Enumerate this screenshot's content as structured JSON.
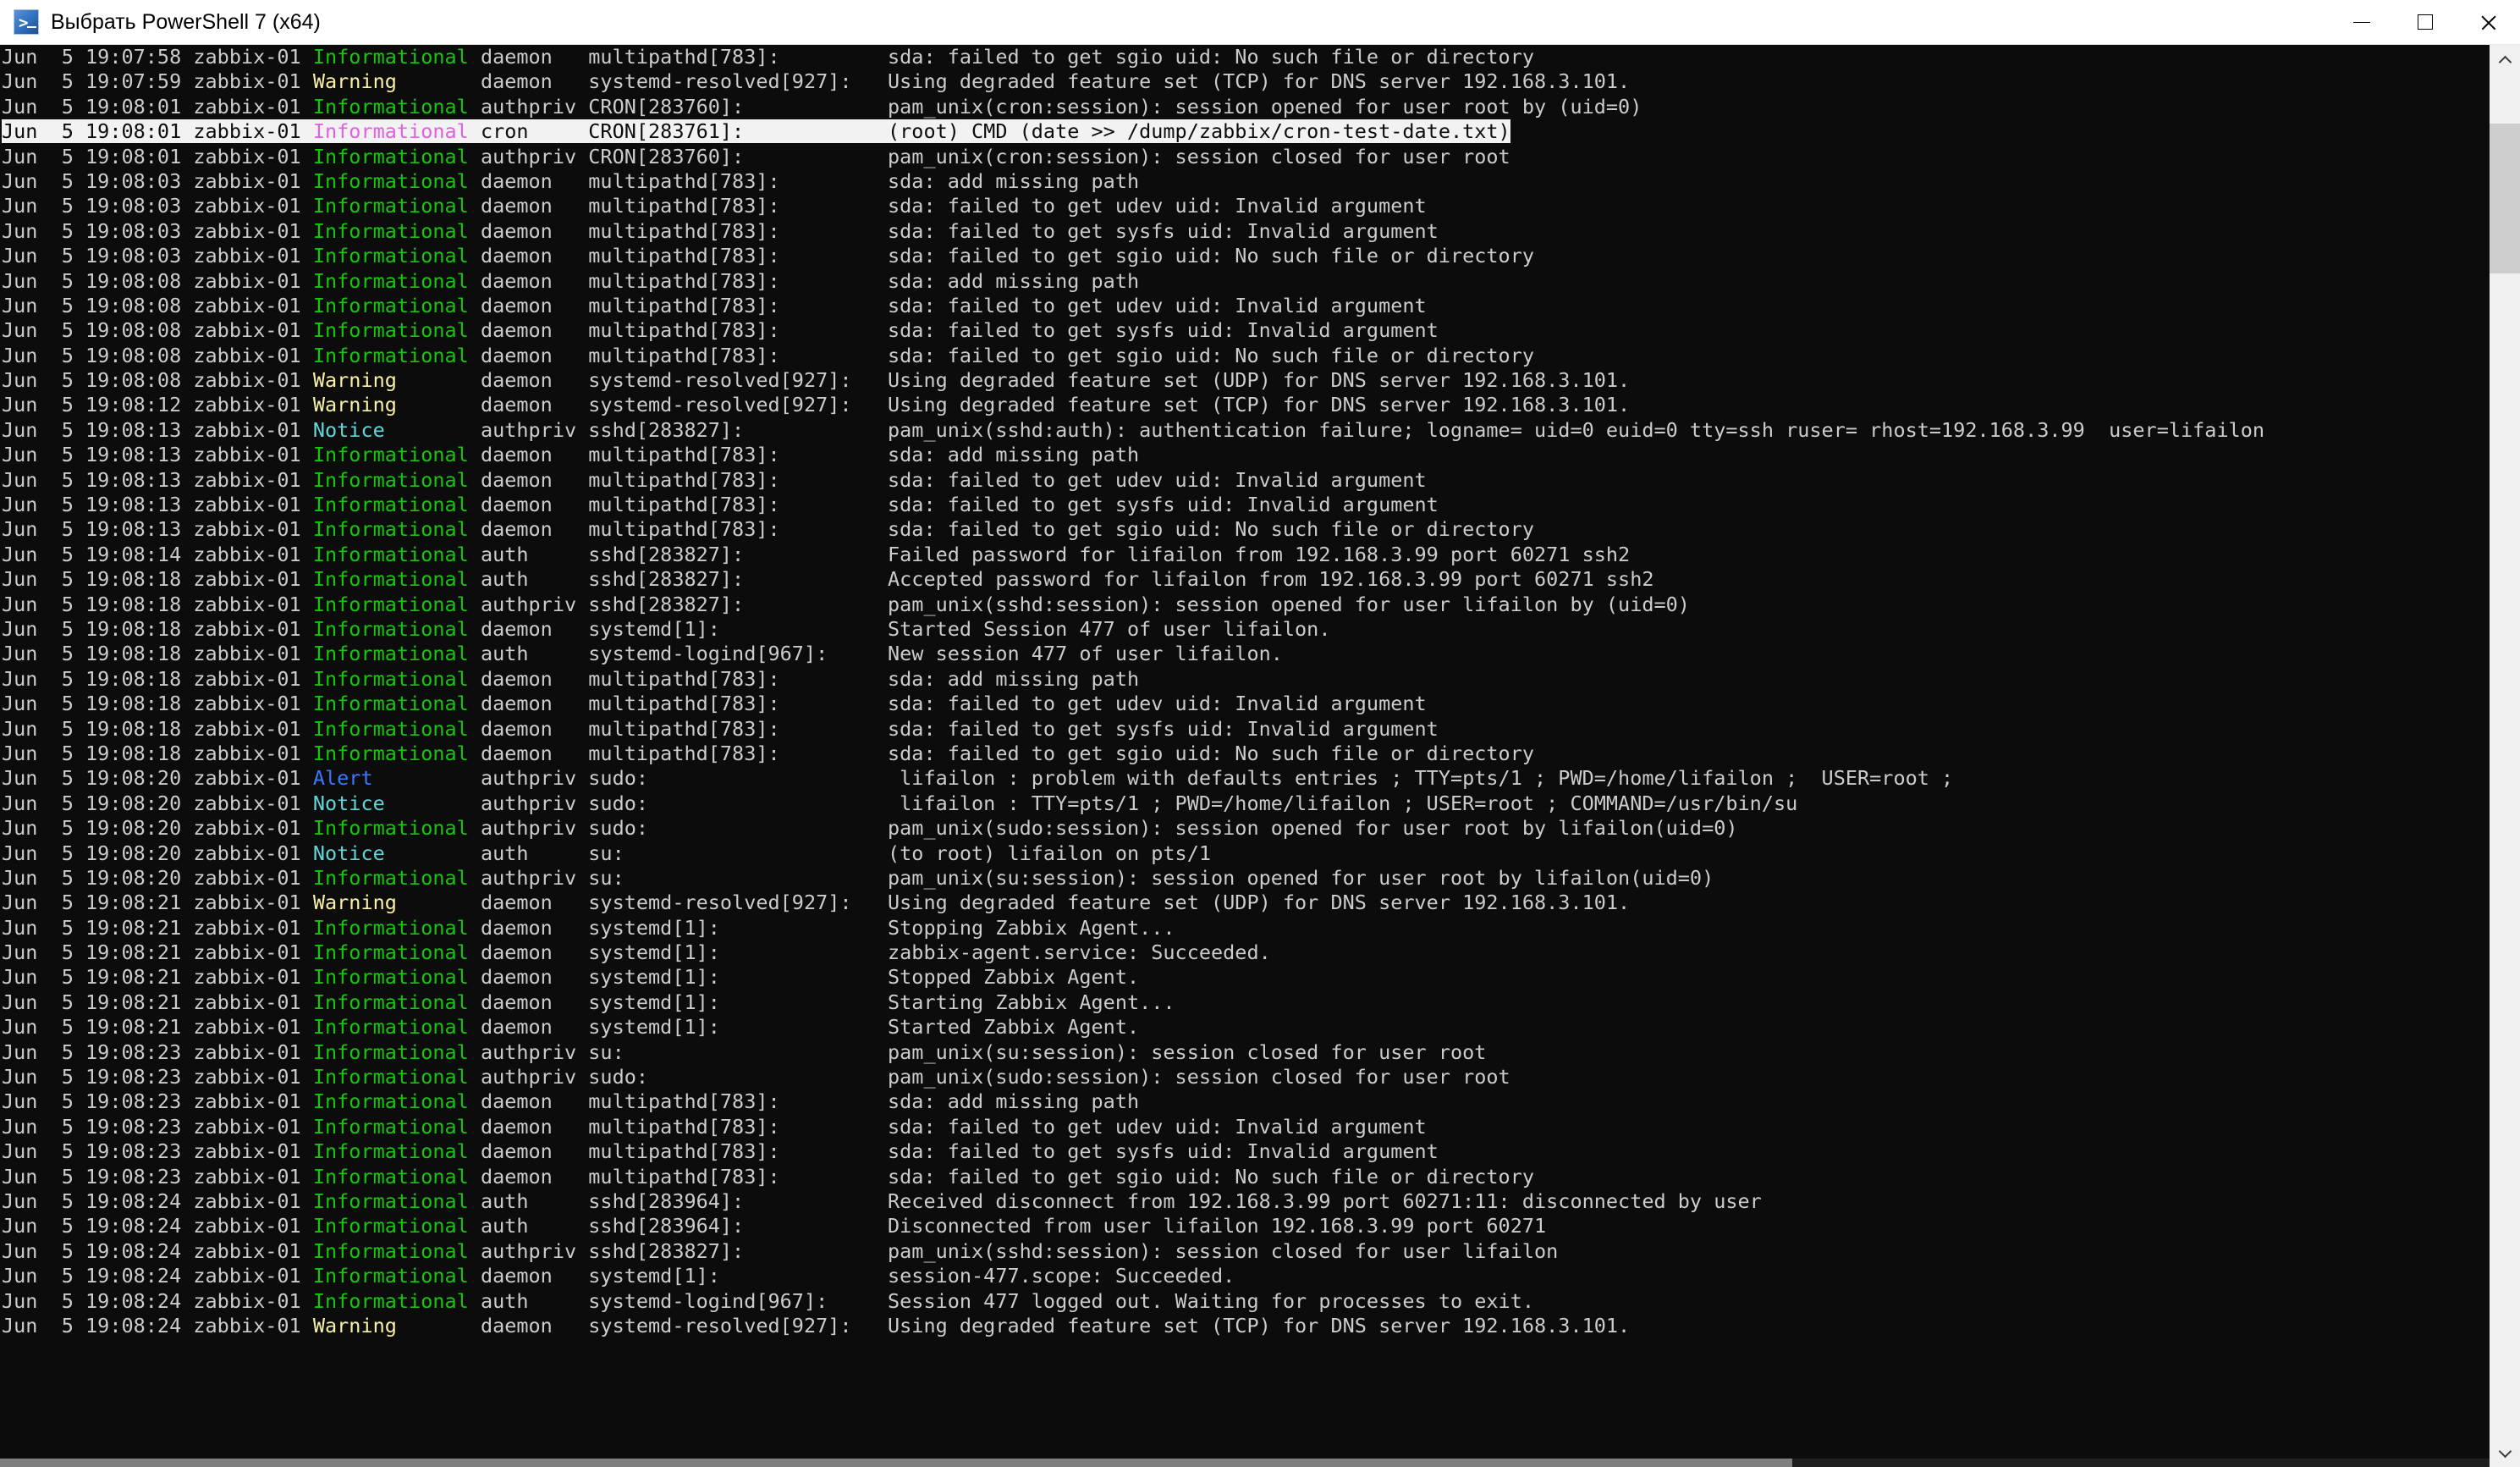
{
  "window": {
    "title": "Выбрать PowerShell 7 (x64)",
    "icon": "powershell-icon",
    "background": "#0c0c0c",
    "titlebar_background": "#ffffff",
    "controls": {
      "minimize": "minimize-icon",
      "maximize": "maximize-icon",
      "close": "close-icon"
    }
  },
  "colors": {
    "informational": "#16c60c",
    "warning": "#f9f1a5",
    "notice": "#61d6d6",
    "alert": "#3b78ff",
    "message": "#cccccc",
    "selection_background": "#f2f2f2",
    "selection_severity": "#e060e0"
  },
  "scrollbars": {
    "vertical": {
      "position_percent": 4,
      "thumb_size_percent": 11
    },
    "horizontal": {
      "position_percent": 0,
      "thumb_size_percent": 72
    }
  },
  "console": {
    "selected_line_index": 3,
    "lines": [
      {
        "ts": "Jun  5 19:07:58 zabbix-01",
        "sev": "Informational",
        "sev_class": "sev-info",
        "facility": "daemon  ",
        "proc": "multipathd[783]:",
        "msg": "sda: failed to get sgio uid: No such file or directory"
      },
      {
        "ts": "Jun  5 19:07:59 zabbix-01",
        "sev": "Warning",
        "sev_class": "sev-warning",
        "facility": "daemon  ",
        "proc": "systemd-resolved[927]:",
        "msg": "Using degraded feature set (TCP) for DNS server 192.168.3.101."
      },
      {
        "ts": "Jun  5 19:08:01 zabbix-01",
        "sev": "Informational",
        "sev_class": "sev-info",
        "facility": "authpriv",
        "proc": "CRON[283760]:",
        "msg": "pam_unix(cron:session): session opened for user root by (uid=0)"
      },
      {
        "ts": "Jun  5 19:08:01 zabbix-01",
        "sev": "Informational",
        "sev_class": "sev-info",
        "facility": "cron    ",
        "proc": "CRON[283761]:",
        "msg": "(root) CMD (date >> /dump/zabbix/cron-test-date.txt)"
      },
      {
        "ts": "Jun  5 19:08:01 zabbix-01",
        "sev": "Informational",
        "sev_class": "sev-info",
        "facility": "authpriv",
        "proc": "CRON[283760]:",
        "msg": "pam_unix(cron:session): session closed for user root"
      },
      {
        "ts": "Jun  5 19:08:03 zabbix-01",
        "sev": "Informational",
        "sev_class": "sev-info",
        "facility": "daemon  ",
        "proc": "multipathd[783]:",
        "msg": "sda: add missing path"
      },
      {
        "ts": "Jun  5 19:08:03 zabbix-01",
        "sev": "Informational",
        "sev_class": "sev-info",
        "facility": "daemon  ",
        "proc": "multipathd[783]:",
        "msg": "sda: failed to get udev uid: Invalid argument"
      },
      {
        "ts": "Jun  5 19:08:03 zabbix-01",
        "sev": "Informational",
        "sev_class": "sev-info",
        "facility": "daemon  ",
        "proc": "multipathd[783]:",
        "msg": "sda: failed to get sysfs uid: Invalid argument"
      },
      {
        "ts": "Jun  5 19:08:03 zabbix-01",
        "sev": "Informational",
        "sev_class": "sev-info",
        "facility": "daemon  ",
        "proc": "multipathd[783]:",
        "msg": "sda: failed to get sgio uid: No such file or directory"
      },
      {
        "ts": "Jun  5 19:08:08 zabbix-01",
        "sev": "Informational",
        "sev_class": "sev-info",
        "facility": "daemon  ",
        "proc": "multipathd[783]:",
        "msg": "sda: add missing path"
      },
      {
        "ts": "Jun  5 19:08:08 zabbix-01",
        "sev": "Informational",
        "sev_class": "sev-info",
        "facility": "daemon  ",
        "proc": "multipathd[783]:",
        "msg": "sda: failed to get udev uid: Invalid argument"
      },
      {
        "ts": "Jun  5 19:08:08 zabbix-01",
        "sev": "Informational",
        "sev_class": "sev-info",
        "facility": "daemon  ",
        "proc": "multipathd[783]:",
        "msg": "sda: failed to get sysfs uid: Invalid argument"
      },
      {
        "ts": "Jun  5 19:08:08 zabbix-01",
        "sev": "Informational",
        "sev_class": "sev-info",
        "facility": "daemon  ",
        "proc": "multipathd[783]:",
        "msg": "sda: failed to get sgio uid: No such file or directory"
      },
      {
        "ts": "Jun  5 19:08:08 zabbix-01",
        "sev": "Warning",
        "sev_class": "sev-warning",
        "facility": "daemon  ",
        "proc": "systemd-resolved[927]:",
        "msg": "Using degraded feature set (UDP) for DNS server 192.168.3.101."
      },
      {
        "ts": "Jun  5 19:08:12 zabbix-01",
        "sev": "Warning",
        "sev_class": "sev-warning",
        "facility": "daemon  ",
        "proc": "systemd-resolved[927]:",
        "msg": "Using degraded feature set (TCP) for DNS server 192.168.3.101."
      },
      {
        "ts": "Jun  5 19:08:13 zabbix-01",
        "sev": "Notice",
        "sev_class": "sev-notice",
        "facility": "authpriv",
        "proc": "sshd[283827]:",
        "msg": "pam_unix(sshd:auth): authentication failure; logname= uid=0 euid=0 tty=ssh ruser= rhost=192.168.3.99  user=lifailon"
      },
      {
        "ts": "Jun  5 19:08:13 zabbix-01",
        "sev": "Informational",
        "sev_class": "sev-info",
        "facility": "daemon  ",
        "proc": "multipathd[783]:",
        "msg": "sda: add missing path"
      },
      {
        "ts": "Jun  5 19:08:13 zabbix-01",
        "sev": "Informational",
        "sev_class": "sev-info",
        "facility": "daemon  ",
        "proc": "multipathd[783]:",
        "msg": "sda: failed to get udev uid: Invalid argument"
      },
      {
        "ts": "Jun  5 19:08:13 zabbix-01",
        "sev": "Informational",
        "sev_class": "sev-info",
        "facility": "daemon  ",
        "proc": "multipathd[783]:",
        "msg": "sda: failed to get sysfs uid: Invalid argument"
      },
      {
        "ts": "Jun  5 19:08:13 zabbix-01",
        "sev": "Informational",
        "sev_class": "sev-info",
        "facility": "daemon  ",
        "proc": "multipathd[783]:",
        "msg": "sda: failed to get sgio uid: No such file or directory"
      },
      {
        "ts": "Jun  5 19:08:14 zabbix-01",
        "sev": "Informational",
        "sev_class": "sev-info",
        "facility": "auth    ",
        "proc": "sshd[283827]:",
        "msg": "Failed password for lifailon from 192.168.3.99 port 60271 ssh2"
      },
      {
        "ts": "Jun  5 19:08:18 zabbix-01",
        "sev": "Informational",
        "sev_class": "sev-info",
        "facility": "auth    ",
        "proc": "sshd[283827]:",
        "msg": "Accepted password for lifailon from 192.168.3.99 port 60271 ssh2"
      },
      {
        "ts": "Jun  5 19:08:18 zabbix-01",
        "sev": "Informational",
        "sev_class": "sev-info",
        "facility": "authpriv",
        "proc": "sshd[283827]:",
        "msg": "pam_unix(sshd:session): session opened for user lifailon by (uid=0)"
      },
      {
        "ts": "Jun  5 19:08:18 zabbix-01",
        "sev": "Informational",
        "sev_class": "sev-info",
        "facility": "daemon  ",
        "proc": "systemd[1]:",
        "msg": "Started Session 477 of user lifailon."
      },
      {
        "ts": "Jun  5 19:08:18 zabbix-01",
        "sev": "Informational",
        "sev_class": "sev-info",
        "facility": "auth    ",
        "proc": "systemd-logind[967]:",
        "msg": "New session 477 of user lifailon."
      },
      {
        "ts": "Jun  5 19:08:18 zabbix-01",
        "sev": "Informational",
        "sev_class": "sev-info",
        "facility": "daemon  ",
        "proc": "multipathd[783]:",
        "msg": "sda: add missing path"
      },
      {
        "ts": "Jun  5 19:08:18 zabbix-01",
        "sev": "Informational",
        "sev_class": "sev-info",
        "facility": "daemon  ",
        "proc": "multipathd[783]:",
        "msg": "sda: failed to get udev uid: Invalid argument"
      },
      {
        "ts": "Jun  5 19:08:18 zabbix-01",
        "sev": "Informational",
        "sev_class": "sev-info",
        "facility": "daemon  ",
        "proc": "multipathd[783]:",
        "msg": "sda: failed to get sysfs uid: Invalid argument"
      },
      {
        "ts": "Jun  5 19:08:18 zabbix-01",
        "sev": "Informational",
        "sev_class": "sev-info",
        "facility": "daemon  ",
        "proc": "multipathd[783]:",
        "msg": "sda: failed to get sgio uid: No such file or directory"
      },
      {
        "ts": "Jun  5 19:08:20 zabbix-01",
        "sev": "Alert",
        "sev_class": "sev-alert",
        "facility": "authpriv",
        "proc": "sudo:",
        "msg": " lifailon : problem with defaults entries ; TTY=pts/1 ; PWD=/home/lifailon ;  USER=root ;"
      },
      {
        "ts": "Jun  5 19:08:20 zabbix-01",
        "sev": "Notice",
        "sev_class": "sev-notice",
        "facility": "authpriv",
        "proc": "sudo:",
        "msg": " lifailon : TTY=pts/1 ; PWD=/home/lifailon ; USER=root ; COMMAND=/usr/bin/su"
      },
      {
        "ts": "Jun  5 19:08:20 zabbix-01",
        "sev": "Informational",
        "sev_class": "sev-info",
        "facility": "authpriv",
        "proc": "sudo:",
        "msg": "pam_unix(sudo:session): session opened for user root by lifailon(uid=0)"
      },
      {
        "ts": "Jun  5 19:08:20 zabbix-01",
        "sev": "Notice",
        "sev_class": "sev-notice",
        "facility": "auth    ",
        "proc": "su:",
        "msg": "(to root) lifailon on pts/1"
      },
      {
        "ts": "Jun  5 19:08:20 zabbix-01",
        "sev": "Informational",
        "sev_class": "sev-info",
        "facility": "authpriv",
        "proc": "su:",
        "msg": "pam_unix(su:session): session opened for user root by lifailon(uid=0)"
      },
      {
        "ts": "Jun  5 19:08:21 zabbix-01",
        "sev": "Warning",
        "sev_class": "sev-warning",
        "facility": "daemon  ",
        "proc": "systemd-resolved[927]:",
        "msg": "Using degraded feature set (UDP) for DNS server 192.168.3.101."
      },
      {
        "ts": "Jun  5 19:08:21 zabbix-01",
        "sev": "Informational",
        "sev_class": "sev-info",
        "facility": "daemon  ",
        "proc": "systemd[1]:",
        "msg": "Stopping Zabbix Agent..."
      },
      {
        "ts": "Jun  5 19:08:21 zabbix-01",
        "sev": "Informational",
        "sev_class": "sev-info",
        "facility": "daemon  ",
        "proc": "systemd[1]:",
        "msg": "zabbix-agent.service: Succeeded."
      },
      {
        "ts": "Jun  5 19:08:21 zabbix-01",
        "sev": "Informational",
        "sev_class": "sev-info",
        "facility": "daemon  ",
        "proc": "systemd[1]:",
        "msg": "Stopped Zabbix Agent."
      },
      {
        "ts": "Jun  5 19:08:21 zabbix-01",
        "sev": "Informational",
        "sev_class": "sev-info",
        "facility": "daemon  ",
        "proc": "systemd[1]:",
        "msg": "Starting Zabbix Agent..."
      },
      {
        "ts": "Jun  5 19:08:21 zabbix-01",
        "sev": "Informational",
        "sev_class": "sev-info",
        "facility": "daemon  ",
        "proc": "systemd[1]:",
        "msg": "Started Zabbix Agent."
      },
      {
        "ts": "Jun  5 19:08:23 zabbix-01",
        "sev": "Informational",
        "sev_class": "sev-info",
        "facility": "authpriv",
        "proc": "su:",
        "msg": "pam_unix(su:session): session closed for user root"
      },
      {
        "ts": "Jun  5 19:08:23 zabbix-01",
        "sev": "Informational",
        "sev_class": "sev-info",
        "facility": "authpriv",
        "proc": "sudo:",
        "msg": "pam_unix(sudo:session): session closed for user root"
      },
      {
        "ts": "Jun  5 19:08:23 zabbix-01",
        "sev": "Informational",
        "sev_class": "sev-info",
        "facility": "daemon  ",
        "proc": "multipathd[783]:",
        "msg": "sda: add missing path"
      },
      {
        "ts": "Jun  5 19:08:23 zabbix-01",
        "sev": "Informational",
        "sev_class": "sev-info",
        "facility": "daemon  ",
        "proc": "multipathd[783]:",
        "msg": "sda: failed to get udev uid: Invalid argument"
      },
      {
        "ts": "Jun  5 19:08:23 zabbix-01",
        "sev": "Informational",
        "sev_class": "sev-info",
        "facility": "daemon  ",
        "proc": "multipathd[783]:",
        "msg": "sda: failed to get sysfs uid: Invalid argument"
      },
      {
        "ts": "Jun  5 19:08:23 zabbix-01",
        "sev": "Informational",
        "sev_class": "sev-info",
        "facility": "daemon  ",
        "proc": "multipathd[783]:",
        "msg": "sda: failed to get sgio uid: No such file or directory"
      },
      {
        "ts": "Jun  5 19:08:24 zabbix-01",
        "sev": "Informational",
        "sev_class": "sev-info",
        "facility": "auth    ",
        "proc": "sshd[283964]:",
        "msg": "Received disconnect from 192.168.3.99 port 60271:11: disconnected by user"
      },
      {
        "ts": "Jun  5 19:08:24 zabbix-01",
        "sev": "Informational",
        "sev_class": "sev-info",
        "facility": "auth    ",
        "proc": "sshd[283964]:",
        "msg": "Disconnected from user lifailon 192.168.3.99 port 60271"
      },
      {
        "ts": "Jun  5 19:08:24 zabbix-01",
        "sev": "Informational",
        "sev_class": "sev-info",
        "facility": "authpriv",
        "proc": "sshd[283827]:",
        "msg": "pam_unix(sshd:session): session closed for user lifailon"
      },
      {
        "ts": "Jun  5 19:08:24 zabbix-01",
        "sev": "Informational",
        "sev_class": "sev-info",
        "facility": "daemon  ",
        "proc": "systemd[1]:",
        "msg": "session-477.scope: Succeeded."
      },
      {
        "ts": "Jun  5 19:08:24 zabbix-01",
        "sev": "Informational",
        "sev_class": "sev-info",
        "facility": "auth    ",
        "proc": "systemd-logind[967]:",
        "msg": "Session 477 logged out. Waiting for processes to exit."
      },
      {
        "ts": "Jun  5 19:08:24 zabbix-01",
        "sev": "Warning",
        "sev_class": "sev-warning",
        "facility": "daemon  ",
        "proc": "systemd-resolved[927]:",
        "msg": "Using degraded feature set (TCP) for DNS server 192.168.3.101."
      }
    ]
  }
}
